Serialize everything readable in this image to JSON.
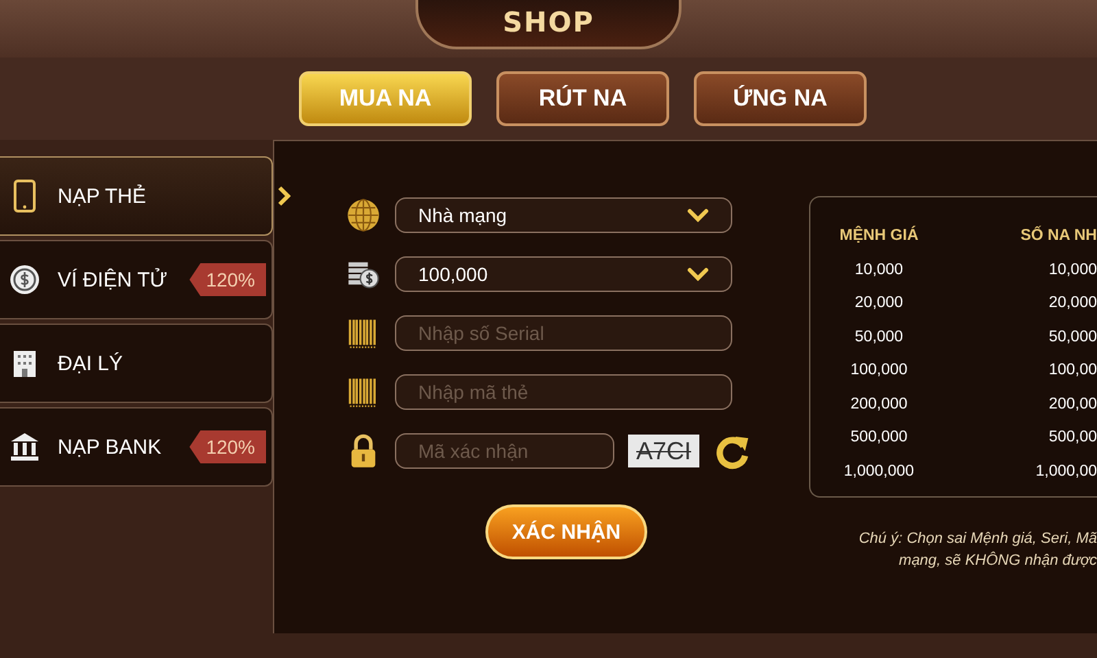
{
  "title": "SHOP",
  "tabs": [
    {
      "label": "MUA NA",
      "selected": true
    },
    {
      "label": "RÚT NA",
      "selected": false
    },
    {
      "label": "ỨNG NA",
      "selected": false
    }
  ],
  "sidebar": {
    "items": [
      {
        "label": "NẠP THẺ",
        "selected": true
      },
      {
        "label": "VÍ ĐIỆN TỬ",
        "selected": false,
        "badge": "120%"
      },
      {
        "label": "ĐẠI LÝ",
        "selected": false
      },
      {
        "label": "NẠP BANK",
        "selected": false,
        "badge": "120%"
      }
    ]
  },
  "form": {
    "fields": [
      {
        "kind": "select",
        "value": "Nhà mạng"
      },
      {
        "kind": "select",
        "value": "100,000"
      },
      {
        "kind": "input",
        "placeholder": "Nhập số Serial"
      },
      {
        "kind": "input",
        "placeholder": "Nhập mã thẻ"
      },
      {
        "kind": "captcha",
        "placeholder": "Mã xác nhận",
        "captcha": "A7CI"
      }
    ],
    "submit": "XÁC NHẬN"
  },
  "rate_table": {
    "columns": [
      "MỆNH GIÁ",
      "SỐ NA NH"
    ],
    "rows": [
      [
        "10,000",
        "10,000"
      ],
      [
        "20,000",
        "20,000"
      ],
      [
        "50,000",
        "50,000"
      ],
      [
        "100,000",
        "100,00"
      ],
      [
        "200,000",
        "200,00"
      ],
      [
        "500,000",
        "500,00"
      ],
      [
        "1,000,000",
        "1,000,00"
      ]
    ]
  },
  "note": [
    "Chú ý: Chọn sai Mệnh giá, Seri, Mã",
    "mạng, sẽ KHÔNG nhận được"
  ]
}
